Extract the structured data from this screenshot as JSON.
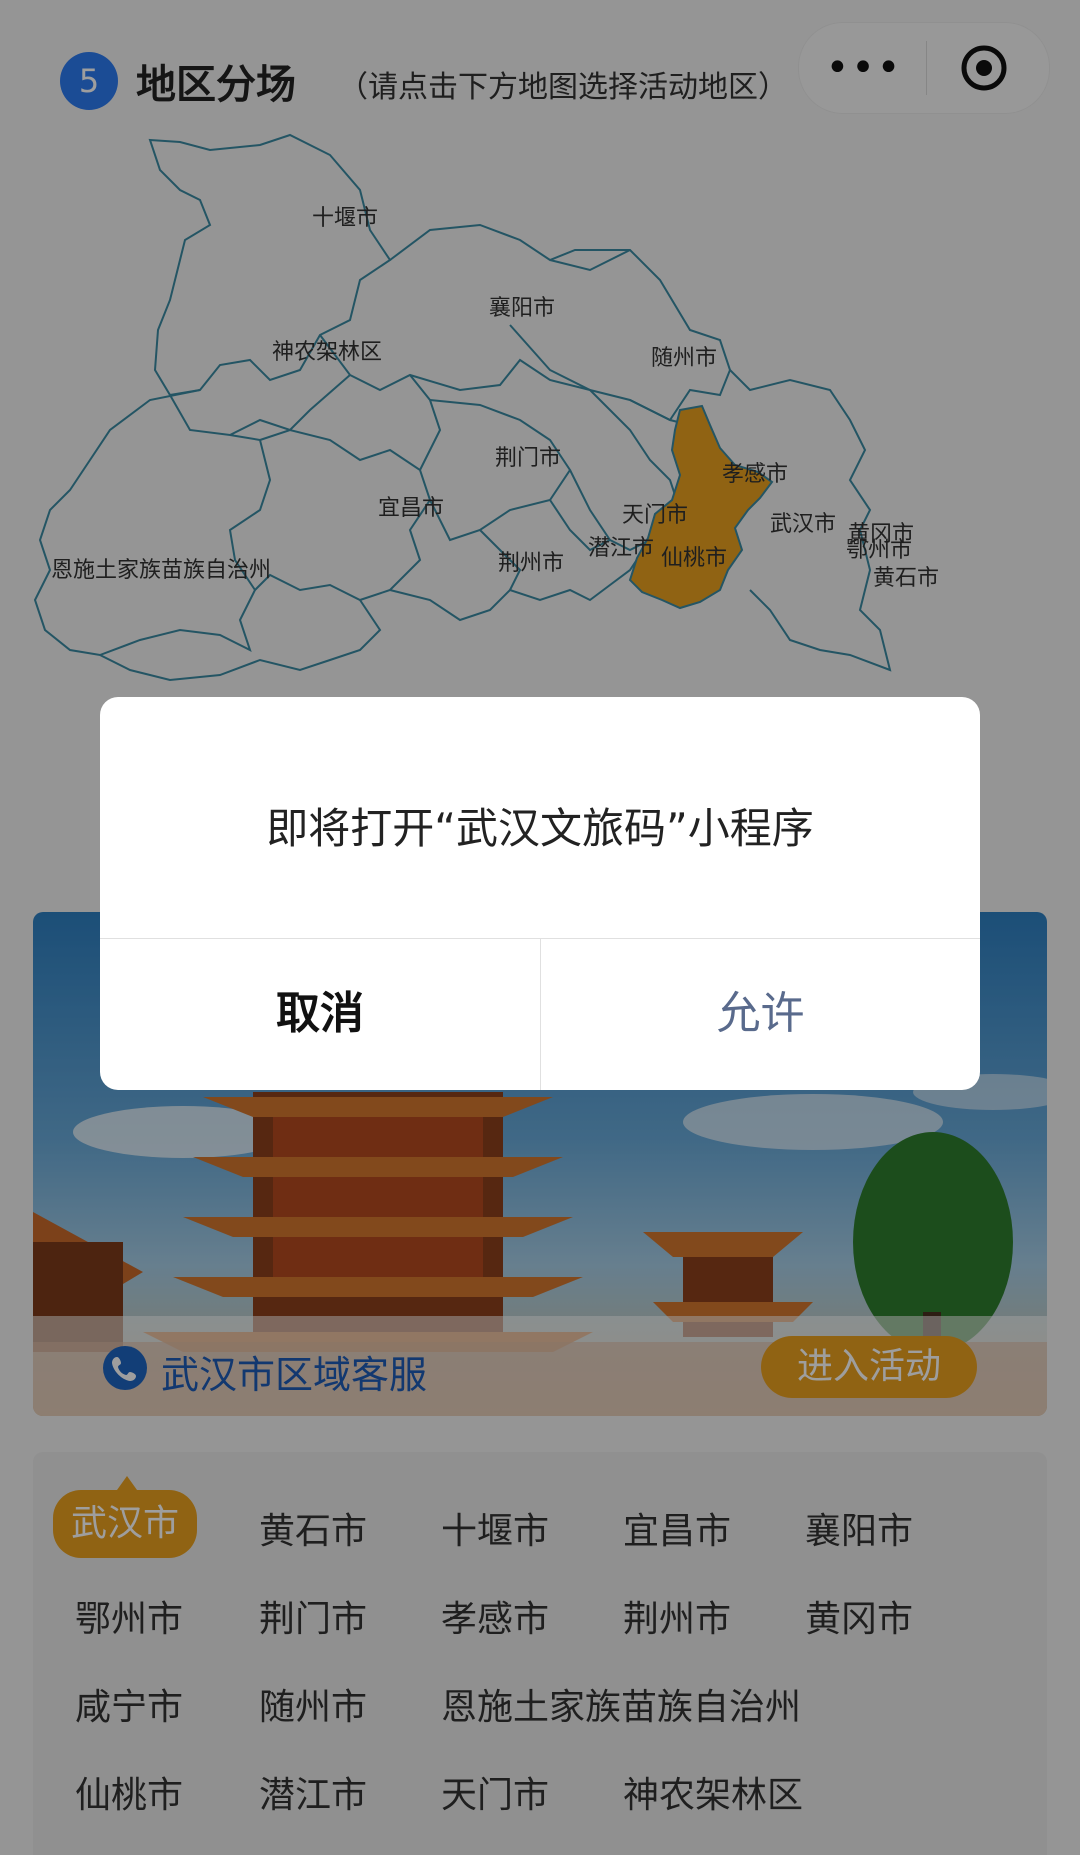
{
  "header": {
    "step_number": "5",
    "title": "地区分场",
    "subtitle": "（请点击下方地图选择活动地区）",
    "more_glyph": "•••"
  },
  "map": {
    "labels": {
      "shiyan": "十堰市",
      "xiangyang": "襄阳市",
      "shennongjia": "神农架林区",
      "suizhou": "随州市",
      "jingmen": "荆门市",
      "xiaogan": "孝感市",
      "yichang": "宜昌市",
      "tianmen": "天门市",
      "wuhan": "武汉市",
      "huanggang": "黄冈市",
      "ezhou": "鄂州市",
      "enshi": "恩施土家族苗族自治州",
      "jingzhou": "荆州市",
      "qianjiang": "潜江市",
      "xiantao": "仙桃市",
      "huangshi": "黄石市"
    },
    "highlight_color": "#e9a020"
  },
  "banner": {
    "hotline_label": "武汉市区域客服",
    "enter_button": "进入活动"
  },
  "cities": {
    "items": [
      "武汉市",
      "黄石市",
      "十堰市",
      "宜昌市",
      "襄阳市",
      "鄂州市",
      "荆门市",
      "孝感市",
      "荆州市",
      "黄冈市",
      "咸宁市",
      "随州市",
      "恩施土家族苗族自治州",
      "仙桃市",
      "潜江市",
      "天门市",
      "神农架林区"
    ],
    "selected": "武汉市"
  },
  "dialog": {
    "message": "即将打开“武汉文旅码”小程序",
    "cancel_label": "取消",
    "allow_label": "允许"
  },
  "colors": {
    "accent_orange": "#e9a020",
    "badge_blue": "#2d7bf0",
    "allow_text": "#596a8c"
  }
}
